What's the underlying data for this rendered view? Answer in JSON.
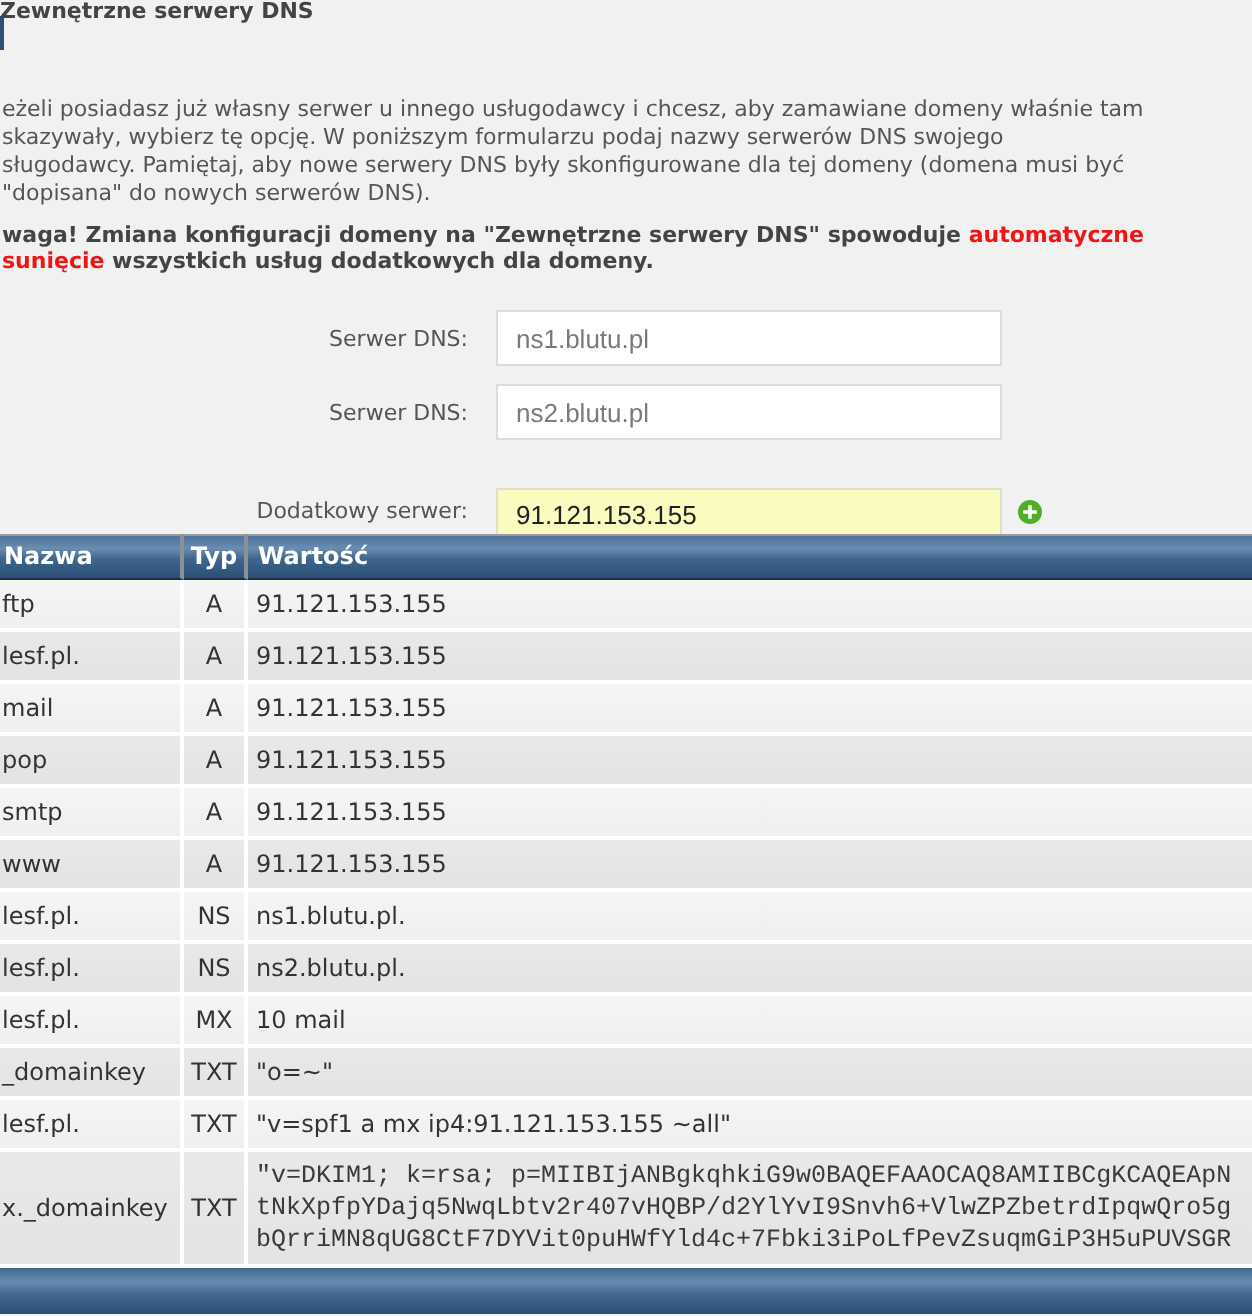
{
  "section": {
    "title": "Zewnętrzne serwery DNS"
  },
  "intro": {
    "lines": [
      "eżeli posiadasz już własny serwer u innego usługodawcy i chcesz, aby zamawiane domeny właśnie tam",
      "skazywały, wybierz tę opcję. W poniższym formularzu podaj nazwy serwerów DNS swojego",
      "sługodawcy. Pamiętaj, aby nowe serwery DNS były skonfigurowane dla tej domeny (domena musi być",
      "\"dopisana\" do nowych serwerów DNS)."
    ]
  },
  "warning": {
    "lines": [
      [
        {
          "text": "waga! Zmiana konfiguracji domeny na \"Zewnętrzne serwery DNS\" spowoduje ",
          "emphasis": false
        },
        {
          "text": "automatyczne",
          "emphasis": true
        }
      ],
      [
        {
          "text": "sunięcie",
          "emphasis": true
        },
        {
          "text": " wszystkich usług dodatkowych dla domeny.",
          "emphasis": false
        }
      ]
    ]
  },
  "dns_form": {
    "fields": [
      {
        "kind": "server",
        "label": "Serwer DNS:",
        "placeholder": "ns1.blutu.pl",
        "highlighted": false
      },
      {
        "kind": "server",
        "label": "Serwer DNS:",
        "placeholder": "ns2.blutu.pl",
        "highlighted": false
      },
      {
        "kind": "additional",
        "label": "Dodatkowy serwer:",
        "value": "91.121.153.155",
        "highlighted": true
      }
    ]
  },
  "records_table": {
    "columns": [
      "Nazwa",
      "Typ",
      "Wartość"
    ],
    "rows": [
      {
        "kind": "text",
        "name": "ftp",
        "type": "A",
        "value": "91.121.153.155"
      },
      {
        "kind": "text",
        "name": "lesf.pl.",
        "type": "A",
        "value": "91.121.153.155"
      },
      {
        "kind": "text",
        "name": "mail",
        "type": "A",
        "value": "91.121.153.155"
      },
      {
        "kind": "text",
        "name": "pop",
        "type": "A",
        "value": "91.121.153.155"
      },
      {
        "kind": "text",
        "name": "smtp",
        "type": "A",
        "value": "91.121.153.155"
      },
      {
        "kind": "text",
        "name": "www",
        "type": "A",
        "value": "91.121.153.155"
      },
      {
        "kind": "text",
        "name": "lesf.pl.",
        "type": "NS",
        "value": "ns1.blutu.pl."
      },
      {
        "kind": "text",
        "name": "lesf.pl.",
        "type": "NS",
        "value": "ns2.blutu.pl."
      },
      {
        "kind": "text",
        "name": "lesf.pl.",
        "type": "MX",
        "value": "10 mail"
      },
      {
        "kind": "text",
        "name": "_domainkey",
        "type": "TXT",
        "value": "\"o=~\""
      },
      {
        "kind": "text",
        "name": "lesf.pl.",
        "type": "TXT",
        "value": "\"v=spf1 a mx ip4:91.121.153.155 ~all\""
      },
      {
        "kind": "code",
        "name": "x._domainkey",
        "type": "TXT",
        "value_lines": [
          "\"v=DKIM1; k=rsa; p=MIIBIjANBgkqhkiG9w0BAQEFAAOCAQ8AMIIBCgKCAQEApN",
          "tNkXpfpYDajq5NwqLbtv2r407vHQBP/d2YlYvI9Snvh6+VlwZPZbetrdIpqwQro5g",
          "bQrriMN8qUG8CtF7DYVit0puHWfYld4c+7Fbki3iPoLfPevZsuqmGiP3H5uPUVSGR"
        ]
      }
    ]
  }
}
